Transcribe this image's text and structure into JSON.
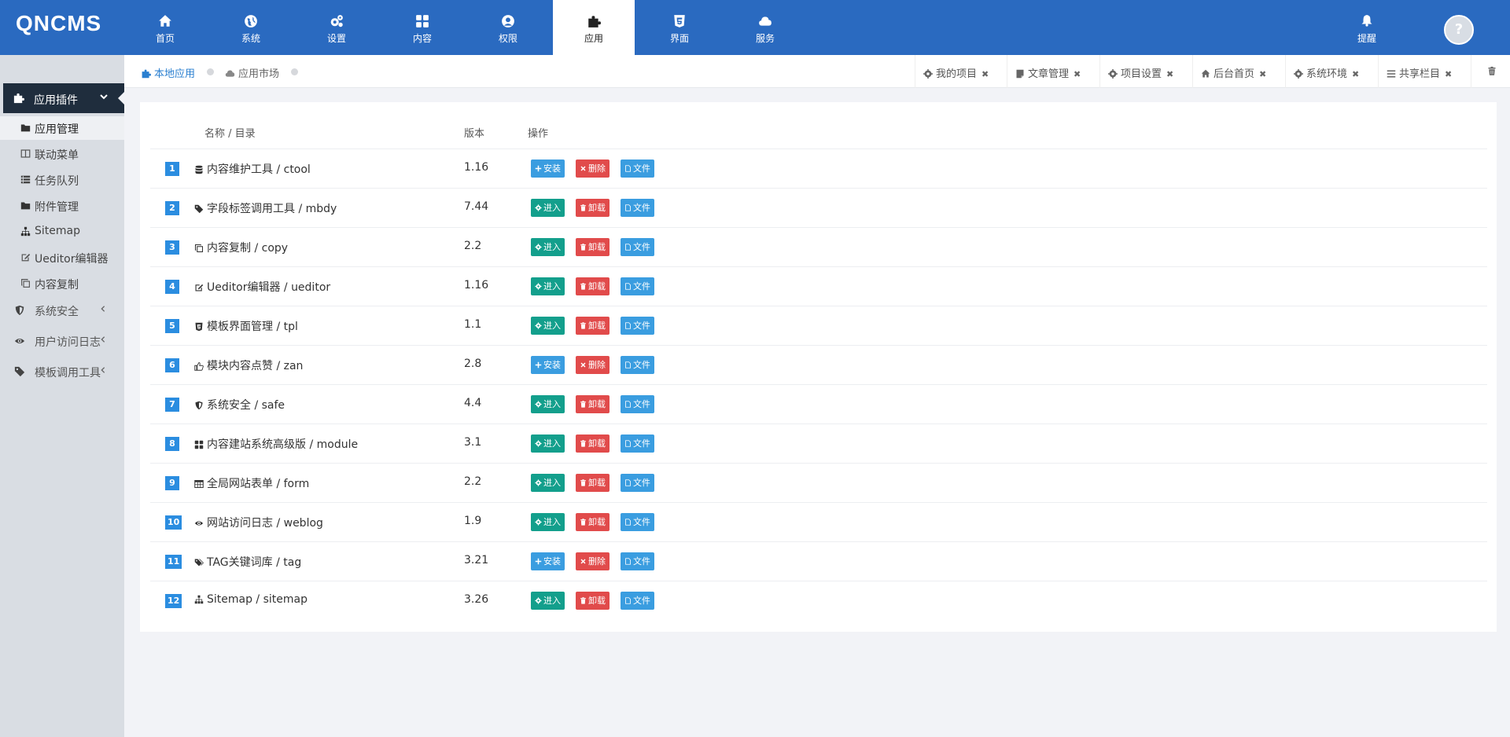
{
  "header": {
    "logo": "QNCMS",
    "nav": [
      {
        "label": "首页",
        "icon": "home-icon"
      },
      {
        "label": "系统",
        "icon": "globe-icon"
      },
      {
        "label": "设置",
        "icon": "cogs-icon"
      },
      {
        "label": "内容",
        "icon": "grid-icon"
      },
      {
        "label": "权限",
        "icon": "user-circle-icon"
      },
      {
        "label": "应用",
        "icon": "puzzle-icon",
        "active": true
      },
      {
        "label": "界面",
        "icon": "html5-icon"
      },
      {
        "label": "服务",
        "icon": "cloud-icon"
      }
    ],
    "notify_label": "提醒",
    "avatar_text": "?"
  },
  "sidebar": {
    "section_title": "应用插件",
    "items": [
      {
        "label": "应用管理",
        "icon": "folder-icon",
        "active": true
      },
      {
        "label": "联动菜单",
        "icon": "columns-icon"
      },
      {
        "label": "任务队列",
        "icon": "list-icon"
      },
      {
        "label": "附件管理",
        "icon": "folder-icon"
      },
      {
        "label": "Sitemap",
        "icon": "sitemap-icon"
      },
      {
        "label": "Ueditor编辑器",
        "icon": "edit-icon"
      },
      {
        "label": "内容复制",
        "icon": "copy-icon"
      }
    ],
    "groups": [
      {
        "label": "系统安全",
        "icon": "shield-icon"
      },
      {
        "label": "用户访问日志",
        "icon": "eye-icon"
      },
      {
        "label": "模板调用工具",
        "icon": "tag-icon"
      }
    ]
  },
  "breadcrumb": {
    "local": "本地应用",
    "market": "应用市场"
  },
  "quick_tabs": [
    {
      "label": "我的项目",
      "icon": "gear-icon"
    },
    {
      "label": "文章管理",
      "icon": "file-icon"
    },
    {
      "label": "项目设置",
      "icon": "gear-icon"
    },
    {
      "label": "后台首页",
      "icon": "home-icon"
    },
    {
      "label": "系统环境",
      "icon": "gear-icon"
    },
    {
      "label": "共享栏目",
      "icon": "bars-icon"
    }
  ],
  "table": {
    "headers": {
      "name": "名称 / 目录",
      "version": "版本",
      "actions": "操作"
    },
    "rows": [
      {
        "num": "1",
        "icon": "database-icon",
        "name": "内容维护工具 / ctool",
        "version": "1.16",
        "installed": false
      },
      {
        "num": "2",
        "icon": "tag-icon",
        "name": "字段标签调用工具 / mbdy",
        "version": "7.44",
        "installed": true
      },
      {
        "num": "3",
        "icon": "copy-icon",
        "name": "内容复制 / copy",
        "version": "2.2",
        "installed": true
      },
      {
        "num": "4",
        "icon": "edit-icon",
        "name": "Ueditor编辑器 / ueditor",
        "version": "1.16",
        "installed": true
      },
      {
        "num": "5",
        "icon": "html5-icon",
        "name": "模板界面管理 / tpl",
        "version": "1.1",
        "installed": true
      },
      {
        "num": "6",
        "icon": "thumbs-up-icon",
        "name": "模块内容点赞 / zan",
        "version": "2.8",
        "installed": false
      },
      {
        "num": "7",
        "icon": "shield-icon",
        "name": "系统安全 / safe",
        "version": "4.4",
        "installed": true
      },
      {
        "num": "8",
        "icon": "grid-icon",
        "name": "内容建站系统高级版 / module",
        "version": "3.1",
        "installed": true
      },
      {
        "num": "9",
        "icon": "table-icon",
        "name": "全局网站表单 / form",
        "version": "2.2",
        "installed": true
      },
      {
        "num": "10",
        "icon": "eye-icon",
        "name": "网站访问日志 / weblog",
        "version": "1.9",
        "installed": true
      },
      {
        "num": "11",
        "icon": "tags-icon",
        "name": "TAG关键词库 / tag",
        "version": "3.21",
        "installed": false
      },
      {
        "num": "12",
        "icon": "sitemap-icon",
        "name": "Sitemap / sitemap",
        "version": "3.26",
        "installed": true
      }
    ],
    "buttons": {
      "install": "安装",
      "delete": "删除",
      "enter": "进入",
      "uninstall": "卸载",
      "file": "文件"
    }
  },
  "colors": {
    "header_bg": "#2a6ac0",
    "enter": "#139f8c",
    "file": "#3a9de0",
    "danger": "#e14b4b",
    "badge": "#2b8de0"
  }
}
